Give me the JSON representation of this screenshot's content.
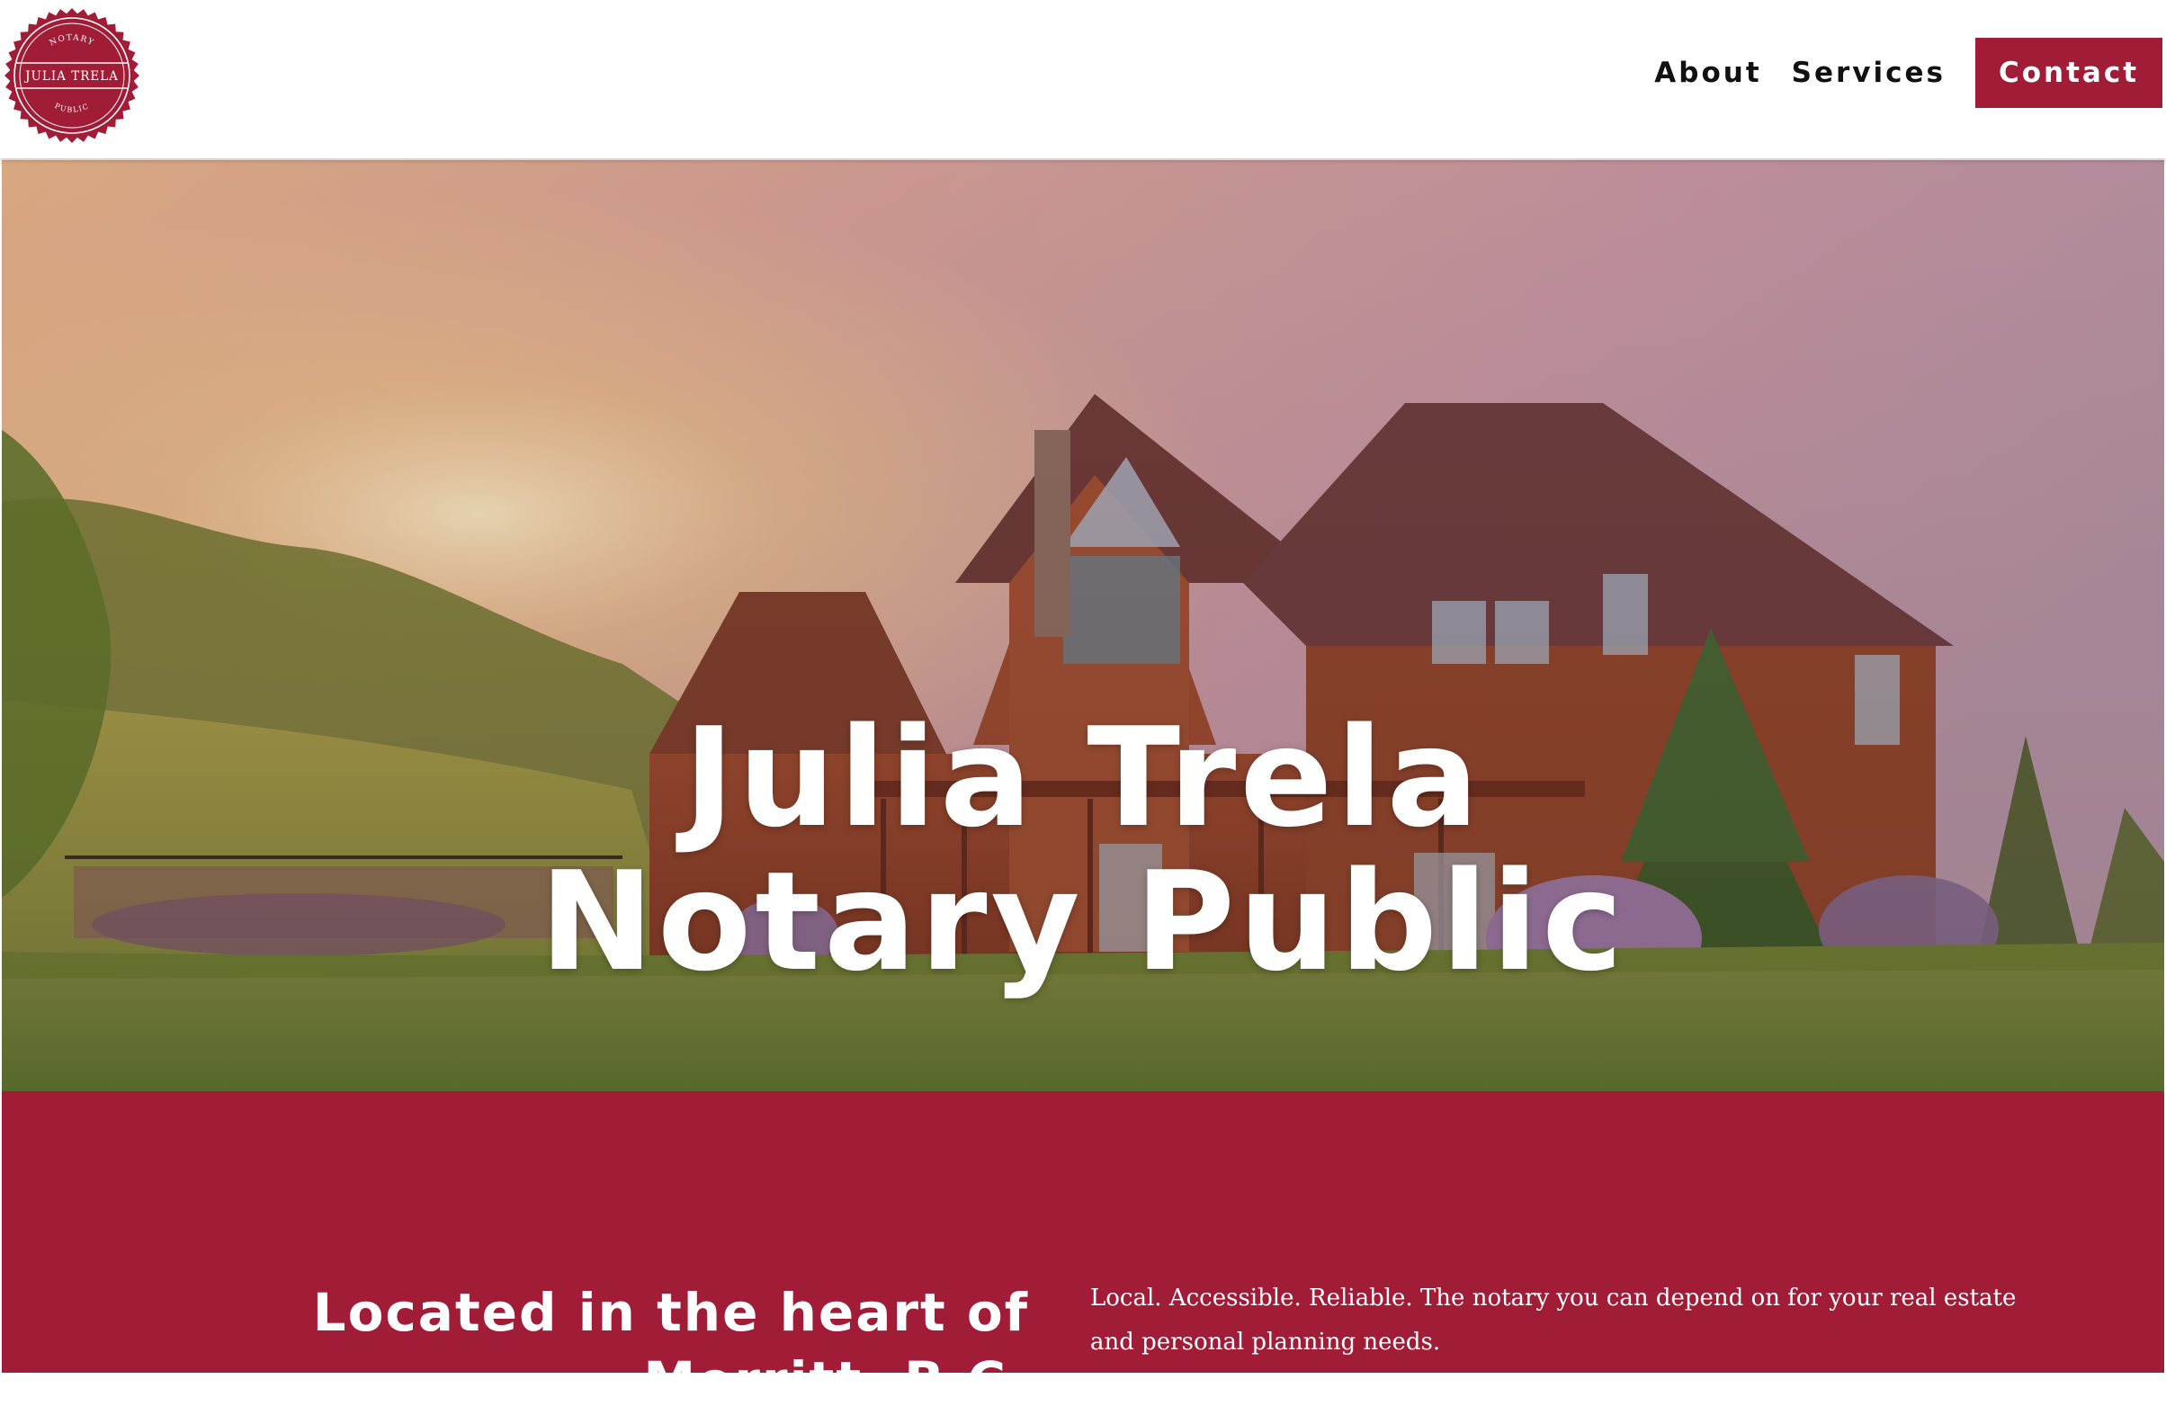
{
  "brand": {
    "seal_name": "JULIA TRELA",
    "seal_top": "NOTARY",
    "seal_bottom": "PUBLIC",
    "color": "#a01c37"
  },
  "nav": {
    "about": "About",
    "services": "Services",
    "contact": "Contact"
  },
  "hero": {
    "title_line1": "Julia Trela",
    "title_line2": "Notary Public"
  },
  "intro": {
    "heading_line1": "Located in the heart of",
    "heading_line2": "Merritt, B.C.",
    "body": "Local. Accessible. Reliable. The notary you can depend on for your real estate and personal planning needs."
  },
  "colors": {
    "accent": "#a01c37",
    "nav_text": "#111111",
    "white": "#ffffff"
  }
}
